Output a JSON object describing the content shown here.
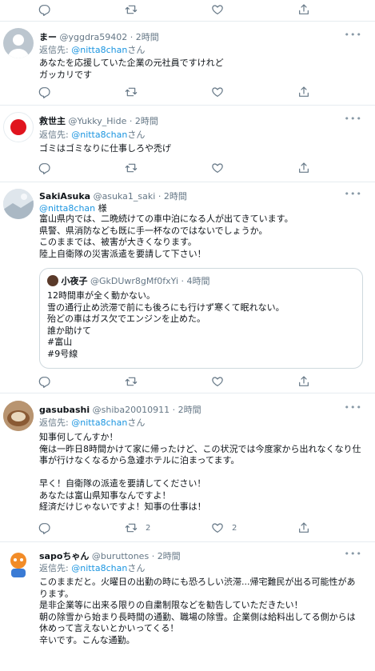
{
  "tweets": [
    {
      "display_name": "まー",
      "handle": "@yggdra59402",
      "time": "2時間",
      "reply_to_label": "返信先:",
      "reply_to": "@nitta8chan",
      "reply_suffix": "さん",
      "text": "あなたを応援していた企業の元社員ですけれど\nガッカリです"
    },
    {
      "display_name": "救世主",
      "handle": "@Yukky_Hide",
      "time": "2時間",
      "reply_to_label": "返信先:",
      "reply_to": "@nitta8chan",
      "reply_suffix": "さん",
      "text": "ゴミはゴミなりに仕事しろや禿げ"
    },
    {
      "display_name": "SakiAsuka",
      "handle": "@asuka1_saki",
      "time": "2時間",
      "mention": "@nitta8chan",
      "mention_suffix": " 様",
      "text": "富山県内では、二晩続けての車中泊になる人が出てきています。\n県警、県消防なども既に手一杯なのではないでしょうか。\nこのままでは、被害が大きくなります。\n陸上自衛隊の災害派遣を要請して下さい！",
      "quote": {
        "display_name": "小夜子",
        "handle": "@GkDUwr8gMf0fxYi",
        "time": "4時間",
        "text": "12時間車が全く動かない。\n雪の通行止め渋滞で前にも後ろにも行けず寒くて眠れない。\n殆どの車はガス欠でエンジンを止めた。\n誰か助けて\n#富山\n#9号線"
      }
    },
    {
      "display_name": "gasubashi",
      "handle": "@shiba20010911",
      "time": "2時間",
      "reply_to_label": "返信先:",
      "reply_to": "@nitta8chan",
      "reply_suffix": "さん",
      "text": "知事何してんすか！\n俺は一昨日8時間かけて家に帰ったけど、この状況では今度家から出れなくなり仕事が行けなくなるから急遽ホテルに泊まってます。\n\n早く！自衛隊の派遣を要請してください！\nあなたは富山県知事なんですよ！\n経済だけじゃないですよ！知事の仕事は！",
      "retweet_count": "2",
      "like_count": "2"
    },
    {
      "display_name": "sapoちゃん",
      "handle": "@buruttones",
      "time": "2時間",
      "reply_to_label": "返信先:",
      "reply_to": "@nitta8chan",
      "reply_suffix": "さん",
      "text": "このままだと。火曜日の出勤の時にも恐ろしい渋滞...帰宅難民が出る可能性があります。\n是非企業等に出来る限りの自粛制限などを勧告していただきたい！\n朝の除雪から始まり長時間の通勤、職場の除雪。企業側は給料出してる側からは休めって言えないとかいってくる！\n辛いです。こんな通勤。"
    }
  ],
  "dot": "·",
  "more": "•••",
  "colors": {
    "link": "#1b95e0",
    "muted": "#657786",
    "divider": "#e6ecf0"
  }
}
